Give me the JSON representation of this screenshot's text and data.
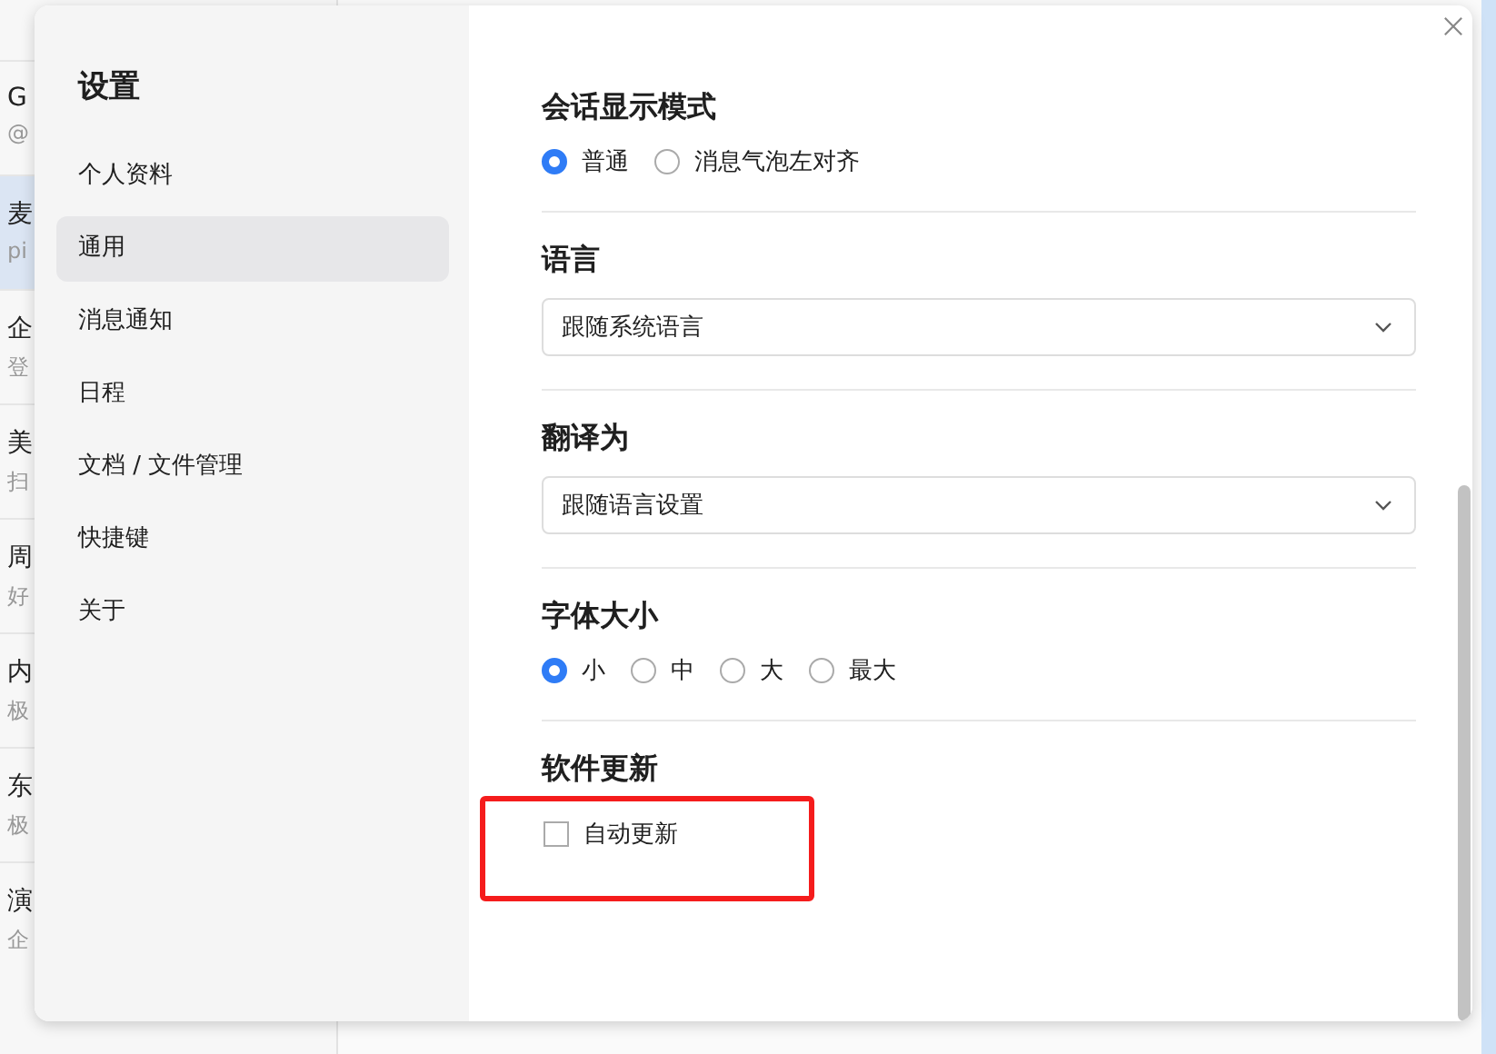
{
  "background_list": {
    "rows": [
      {
        "title": "G",
        "subtitle": "@",
        "selected": false
      },
      {
        "title": "麦",
        "subtitle": "pi",
        "selected": true
      },
      {
        "title": "企",
        "subtitle": "登",
        "selected": false
      },
      {
        "title": "美",
        "subtitle": "扫",
        "selected": false
      },
      {
        "title": "周",
        "subtitle": "好",
        "selected": false
      },
      {
        "title": "内",
        "subtitle": "极",
        "selected": false
      },
      {
        "title": "东",
        "subtitle": "极",
        "selected": false
      },
      {
        "title": "演",
        "subtitle": "企",
        "selected": false
      }
    ]
  },
  "dialog": {
    "title": "设置",
    "sidebar": {
      "items": [
        {
          "label": "个人资料",
          "selected": false
        },
        {
          "label": "通用",
          "selected": true
        },
        {
          "label": "消息通知",
          "selected": false
        },
        {
          "label": "日程",
          "selected": false
        },
        {
          "label": "文档 / 文件管理",
          "selected": false
        },
        {
          "label": "快捷键",
          "selected": false
        },
        {
          "label": "关于",
          "selected": false
        }
      ]
    },
    "sections": [
      {
        "kind": "radio",
        "title": "会话显示模式",
        "options": [
          {
            "label": "普通",
            "selected": true
          },
          {
            "label": "消息气泡左对齐",
            "selected": false
          }
        ]
      },
      {
        "kind": "select",
        "title": "语言",
        "value": "跟随系统语言"
      },
      {
        "kind": "select",
        "title": "翻译为",
        "value": "跟随语言设置"
      },
      {
        "kind": "radio",
        "title": "字体大小",
        "options": [
          {
            "label": "小",
            "selected": true
          },
          {
            "label": "中",
            "selected": false
          },
          {
            "label": "大",
            "selected": false
          },
          {
            "label": "最大",
            "selected": false
          }
        ]
      },
      {
        "kind": "checkbox",
        "title": "软件更新",
        "options": [
          {
            "label": "自动更新",
            "checked": false,
            "highlighted": true
          }
        ]
      }
    ]
  }
}
